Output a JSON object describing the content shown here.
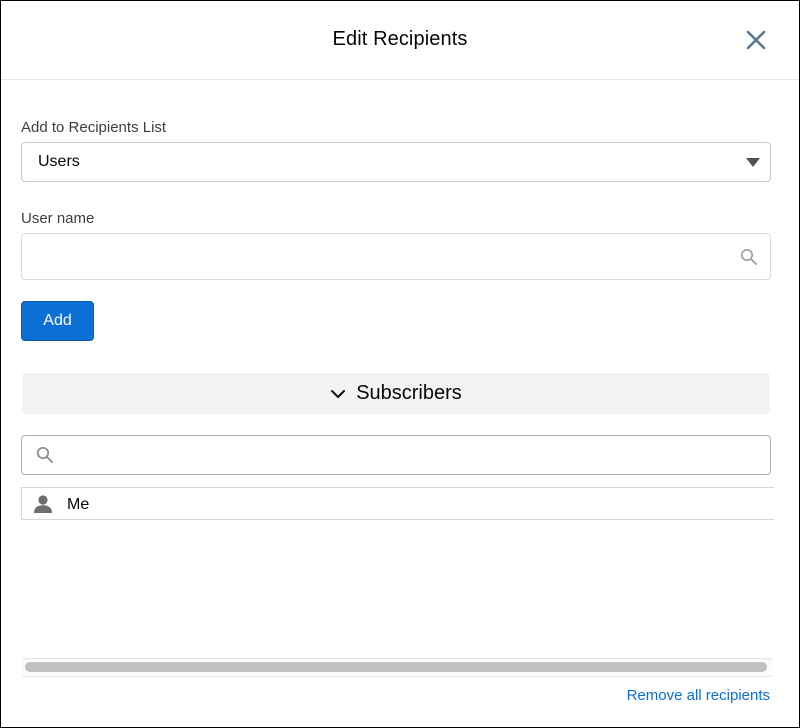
{
  "modal": {
    "title": "Edit Recipients",
    "close_icon": "close-icon"
  },
  "recipients_list": {
    "label": "Add to Recipients List",
    "selected": "Users",
    "caret_icon": "caret-down-icon"
  },
  "user_name": {
    "label": "User name",
    "value": "",
    "placeholder": "",
    "icon": "search-icon"
  },
  "add_button": {
    "label": "Add"
  },
  "subscribers": {
    "title": "Subscribers",
    "expanded": true,
    "toggle_icon": "chevron-down-icon",
    "filter": {
      "value": "",
      "placeholder": "",
      "icon": "search-icon"
    },
    "items": [
      {
        "name": "Me",
        "icon": "user-icon"
      }
    ]
  },
  "footer": {
    "remove_all_label": "Remove all recipients"
  },
  "colors": {
    "brand": "#0b6fd6",
    "section_bg": "#f3f3f3",
    "close_icon": "#5b7891",
    "text": "#080707"
  }
}
